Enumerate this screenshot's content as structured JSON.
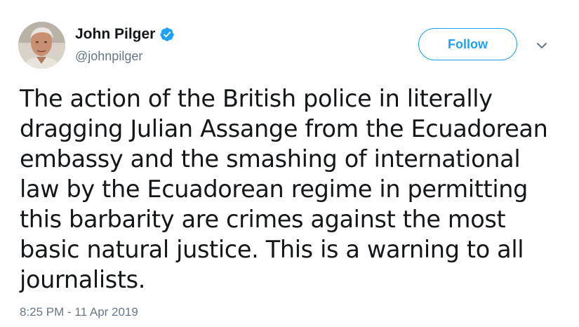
{
  "author": {
    "display_name": "John Pilger",
    "handle": "@johnpilger",
    "verified": true,
    "avatar_icon": "profile-photo"
  },
  "actions": {
    "follow_label": "Follow",
    "menu_icon": "chevron-down-icon"
  },
  "tweet": {
    "lines": [
      "The action of the British police in literally",
      "dragging Julian Assange from the Ecuadorean",
      "embassy and the smashing of international",
      "law by the Ecuadorean regime in permitting",
      "this barbarity are crimes against the most",
      "basic natural justice. This is a warning to all",
      "journalists."
    ],
    "timestamp": "8:25 PM - 11 Apr 2019"
  },
  "colors": {
    "accent": "#1da1f2",
    "text": "#14171a",
    "secondary": "#657786"
  }
}
